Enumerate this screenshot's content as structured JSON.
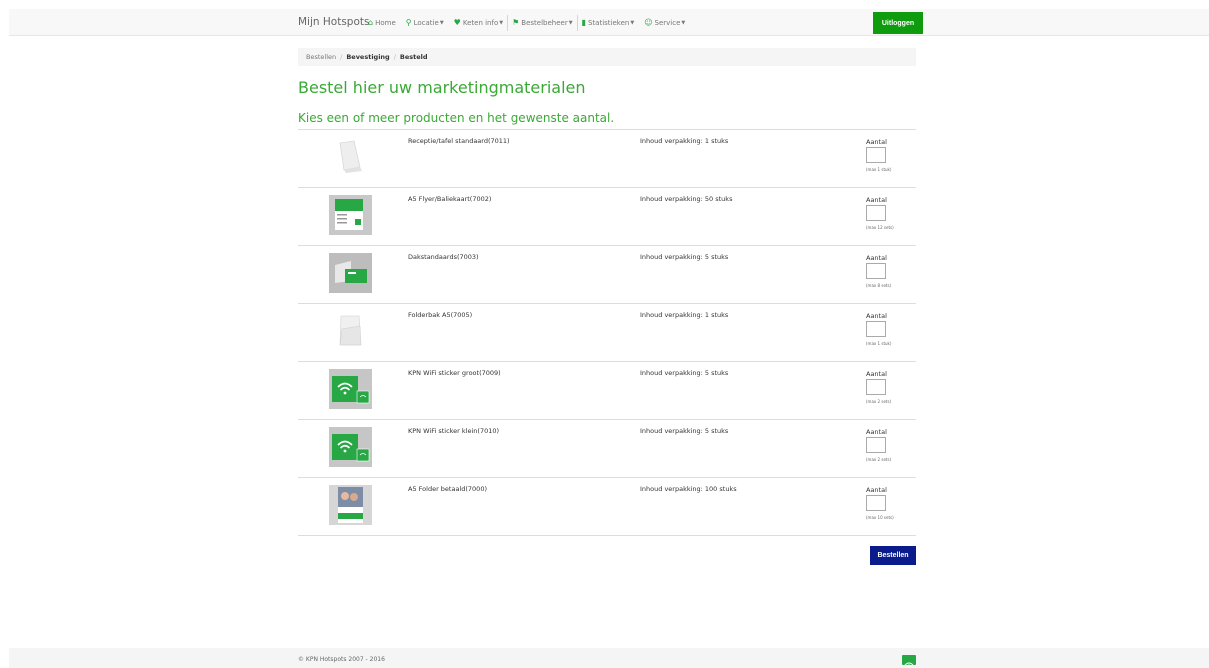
{
  "header": {
    "brand": "Mijn Hotspots",
    "nav": [
      {
        "label": "Home",
        "icon": "home-icon",
        "dropdown": false
      },
      {
        "label": "Locatie",
        "icon": "map-pin-icon",
        "dropdown": true
      },
      {
        "label": "Keten info",
        "icon": "heart-icon",
        "dropdown": true
      },
      {
        "label": "Bestelbeheer",
        "icon": "flag-icon",
        "dropdown": true
      },
      {
        "label": "Statistieken",
        "icon": "bar-chart-icon",
        "dropdown": true
      },
      {
        "label": "Service",
        "icon": "users-icon",
        "dropdown": true
      }
    ],
    "logout_label": "Uitloggen"
  },
  "breadcrumb": {
    "items": [
      "Bestellen",
      "Bevestiging",
      "Besteld"
    ]
  },
  "main": {
    "title": "Bestel hier uw marketingmaterialen",
    "subtitle": "Kies een of meer producten en het gewenste aantal.",
    "qty_label": "Aantal",
    "products": [
      {
        "name": "Receptie/tafel standaard(7011)",
        "inhoud": "Inhoud verpakking: 1 stuks",
        "max": "(max 1 stuk)",
        "image": "stand"
      },
      {
        "name": "A5 Flyer/Baliekaart(7002)",
        "inhoud": "Inhoud verpakking: 50 stuks",
        "max": "(max 12 sets)",
        "image": "flyer"
      },
      {
        "name": "Dakstandaards(7003)",
        "inhoud": "Inhoud verpakking: 5 stuks",
        "max": "(max 8 sets)",
        "image": "dak"
      },
      {
        "name": "Folderbak A5(7005)",
        "inhoud": "Inhoud verpakking: 1 stuks",
        "max": "(max 1 stuk)",
        "image": "folderbak"
      },
      {
        "name": "KPN WiFi sticker groot(7009)",
        "inhoud": "Inhoud verpakking: 5 stuks",
        "max": "(max 2 sets)",
        "image": "wifi"
      },
      {
        "name": "KPN WiFi sticker klein(7010)",
        "inhoud": "Inhoud verpakking: 5 stuks",
        "max": "(max 2 sets)",
        "image": "wifi"
      },
      {
        "name": "A5 Folder betaald(7000)",
        "inhoud": "Inhoud verpakking: 100 stuks",
        "max": "(max 10 sets)",
        "image": "folder"
      }
    ],
    "order_label": "Bestellen"
  },
  "footer": {
    "copyright": "© KPN Hotspots 2007 - 2016"
  },
  "colors": {
    "accent_green": "#3aa935",
    "logout_green": "#0e9b0e",
    "order_blue": "#0a1c8c"
  }
}
